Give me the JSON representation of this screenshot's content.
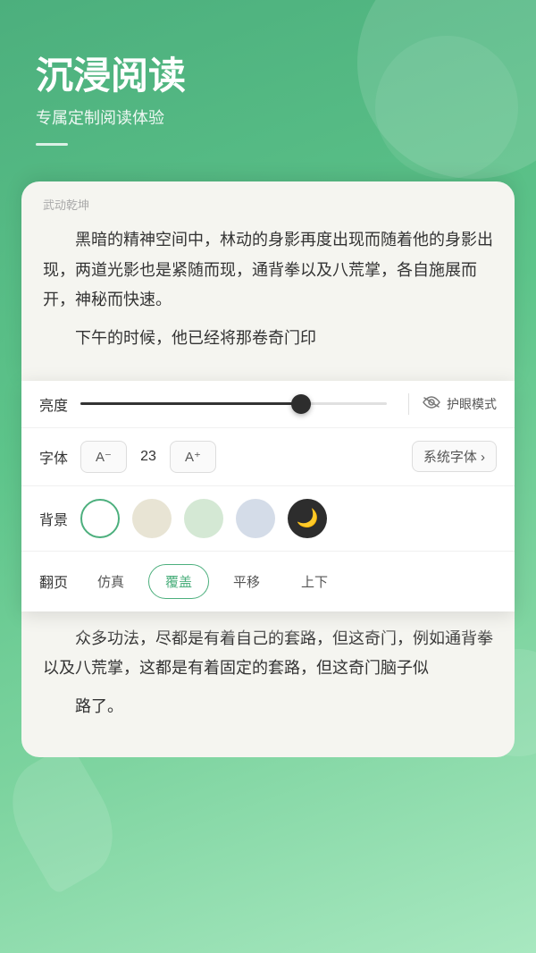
{
  "header": {
    "title": "沉浸阅读",
    "subtitle": "专属定制阅读体验"
  },
  "reader": {
    "book_title": "武动乾坤",
    "paragraph1": "黑暗的精神空间中，林动的身影再度出现而随着他的身影出现，两道光影也是紧随而现，通背拳以及八荒掌，各自施展而开，神秘而快速。",
    "paragraph2": "下午的时候，他已经将那卷奇门印"
  },
  "settings": {
    "brightness_label": "亮度",
    "brightness_value": 72,
    "eye_mode_label": "护眼模式",
    "font_label": "字体",
    "font_decrease": "A⁻",
    "font_size": "23",
    "font_increase": "A⁺",
    "font_family": "系统字体 ›",
    "bg_label": "背景",
    "pageturn_label": "翻页",
    "pageturn_options": [
      "仿真",
      "覆盖",
      "平移",
      "上下"
    ],
    "pageturn_active": "覆盖"
  },
  "bottom": {
    "paragraph1": "众多功法，尽都是有着自己的套路，但这奇门，例如通背拳以及八荒掌，这都是有着固定的套路，但这奇门脑子似",
    "paragraph2": "路了。"
  },
  "icons": {
    "eye": "⌒",
    "moon": "🌙",
    "chevron": "›"
  }
}
